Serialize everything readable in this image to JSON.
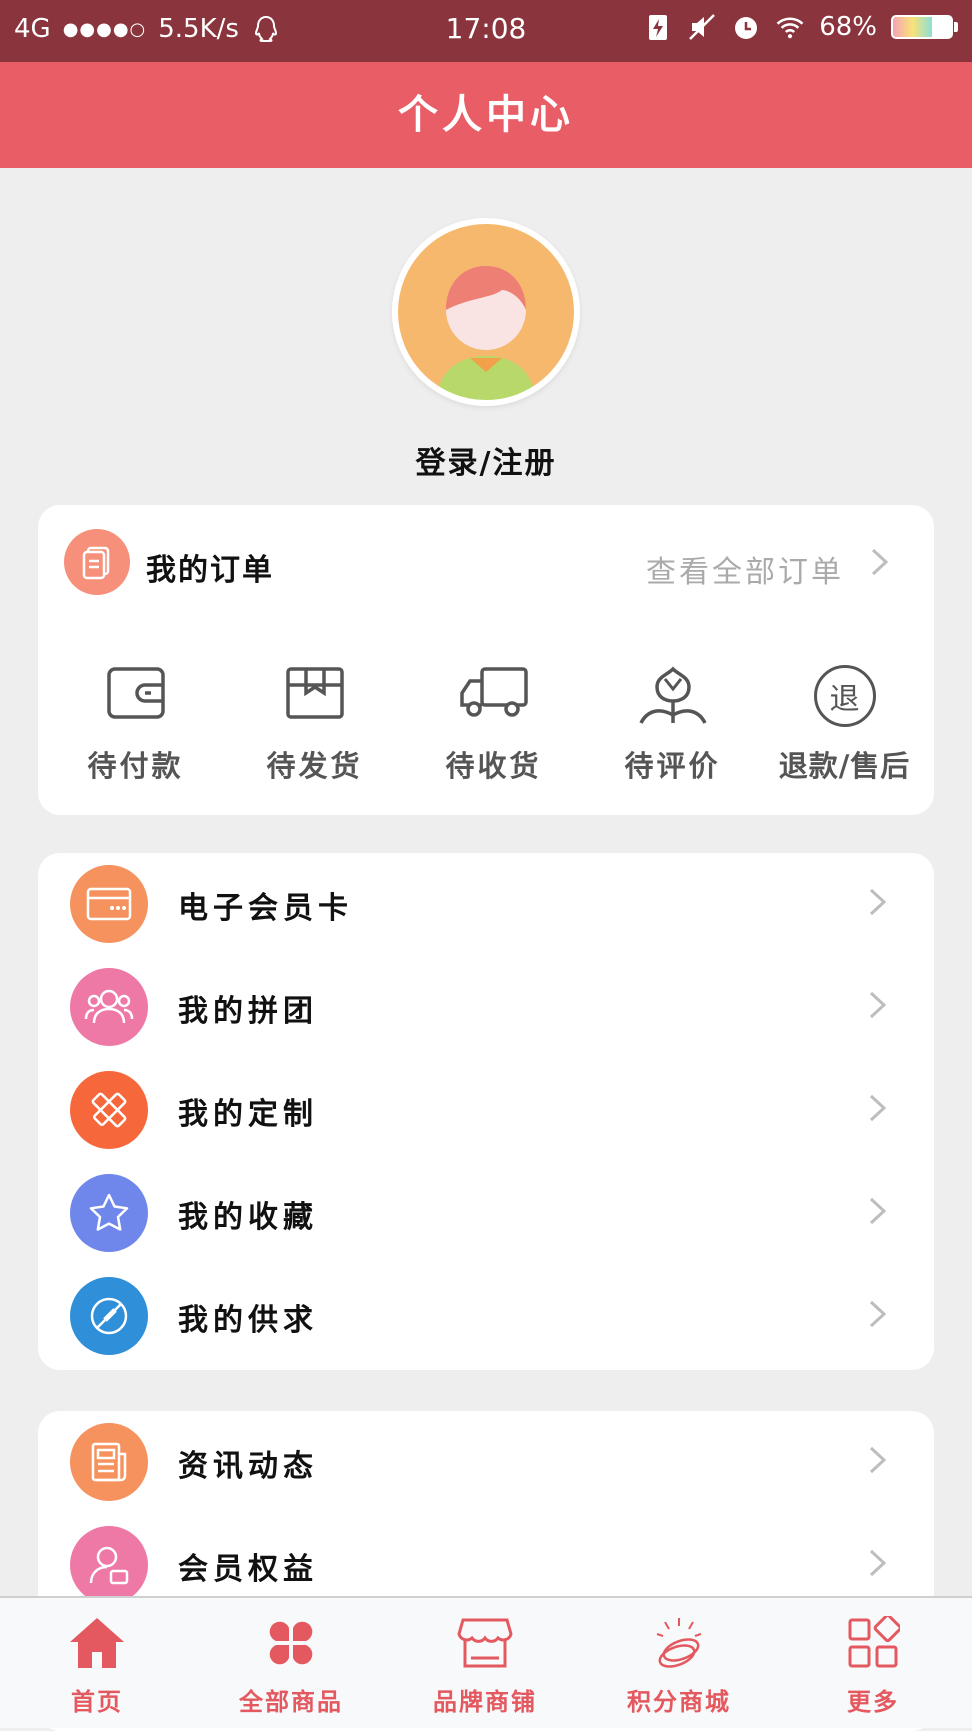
{
  "status_bar": {
    "network": "4G",
    "signal_dots": "●●●●○",
    "speed": "5.5K/s",
    "time": "17:08",
    "battery": "68%",
    "battery_level": 0.68
  },
  "header": {
    "title": "个人中心"
  },
  "profile": {
    "login_label": "登录/注册"
  },
  "orders": {
    "title": "我的订单",
    "view_all": "查看全部订单",
    "statuses": [
      {
        "label": "待付款",
        "icon": "wallet-icon"
      },
      {
        "label": "待发货",
        "icon": "package-icon"
      },
      {
        "label": "待收货",
        "icon": "truck-icon"
      },
      {
        "label": "待评价",
        "icon": "flower-icon"
      },
      {
        "label": "退款/售后",
        "icon": "refund-icon",
        "icon_text": "退"
      }
    ]
  },
  "menu_group_1": [
    {
      "label": "电子会员卡",
      "icon": "card-icon",
      "color": "#f5925d"
    },
    {
      "label": "我的拼团",
      "icon": "group-icon",
      "color": "#ee79a6"
    },
    {
      "label": "我的定制",
      "icon": "tools-icon",
      "color": "#f6683b"
    },
    {
      "label": "我的收藏",
      "icon": "star-icon",
      "color": "#6f87ea"
    },
    {
      "label": "我的供求",
      "icon": "compass-icon",
      "color": "#2f8fd8"
    }
  ],
  "menu_group_2": [
    {
      "label": "资讯动态",
      "icon": "news-icon",
      "color": "#f5925d"
    },
    {
      "label": "会员权益",
      "icon": "member-icon",
      "color": "#ee79a6"
    }
  ],
  "bottom_nav": [
    {
      "label": "首页",
      "icon": "home-icon"
    },
    {
      "label": "全部商品",
      "icon": "grid-petal-icon"
    },
    {
      "label": "品牌商铺",
      "icon": "shop-icon"
    },
    {
      "label": "积分商城",
      "icon": "coins-icon"
    },
    {
      "label": "更多",
      "icon": "more-icon"
    }
  ],
  "colors": {
    "header": "#e95d67",
    "status_bar": "#8a353d",
    "accent": "#e45960"
  }
}
